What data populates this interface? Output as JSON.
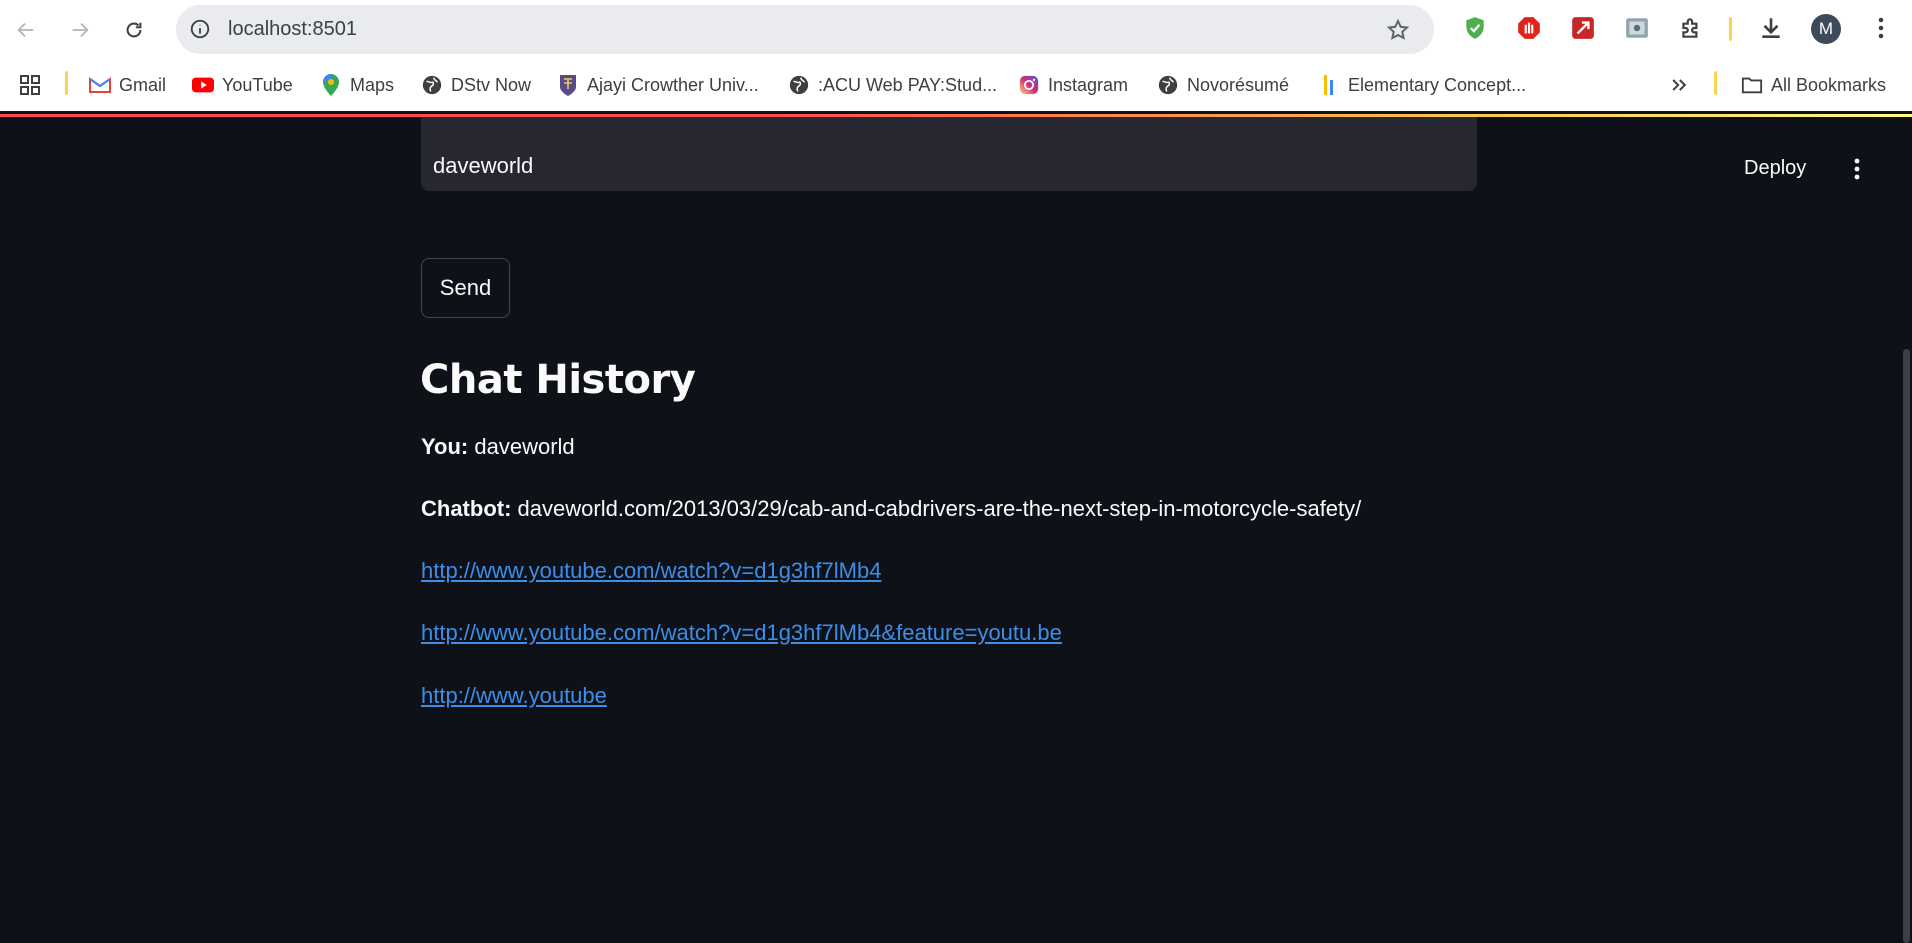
{
  "browser": {
    "url": "localhost:8501",
    "bookmarks": [
      {
        "label": "Gmail",
        "icon": "gmail-icon"
      },
      {
        "label": "YouTube",
        "icon": "youtube-icon"
      },
      {
        "label": "Maps",
        "icon": "maps-icon"
      },
      {
        "label": "DStv Now",
        "icon": "globe-icon"
      },
      {
        "label": "Ajayi Crowther Univ...",
        "icon": "university-icon"
      },
      {
        "label": ":ACU Web PAY:Stud...",
        "icon": "globe-icon"
      },
      {
        "label": "Instagram",
        "icon": "instagram-icon"
      },
      {
        "label": "Novorésumé",
        "icon": "globe-icon"
      },
      {
        "label": "Elementary Concept...",
        "icon": "bars-icon"
      }
    ],
    "all_bookmarks": "All Bookmarks",
    "avatar_initial": "M"
  },
  "app": {
    "deploy_label": "Deploy",
    "input_value": "daveworld",
    "send_label": "Send",
    "history_title": "Chat History",
    "messages": {
      "user_label": "You:",
      "user_text": "daveworld",
      "bot_label": "Chatbot:",
      "bot_text": "daveworld.com/2013/03/29/cab-and-cabdrivers-are-the-next-step-in-motorcycle-safety/",
      "links": [
        "http://www.youtube.com/watch?v=d1g3hf7lMb4",
        "http://www.youtube.com/watch?v=d1g3hf7lMb4&feature=youtu.be",
        "http://www.youtube"
      ]
    }
  },
  "colors": {
    "app_background": "#0e1117",
    "link": "#3d8ee8",
    "input_background": "#262730"
  }
}
